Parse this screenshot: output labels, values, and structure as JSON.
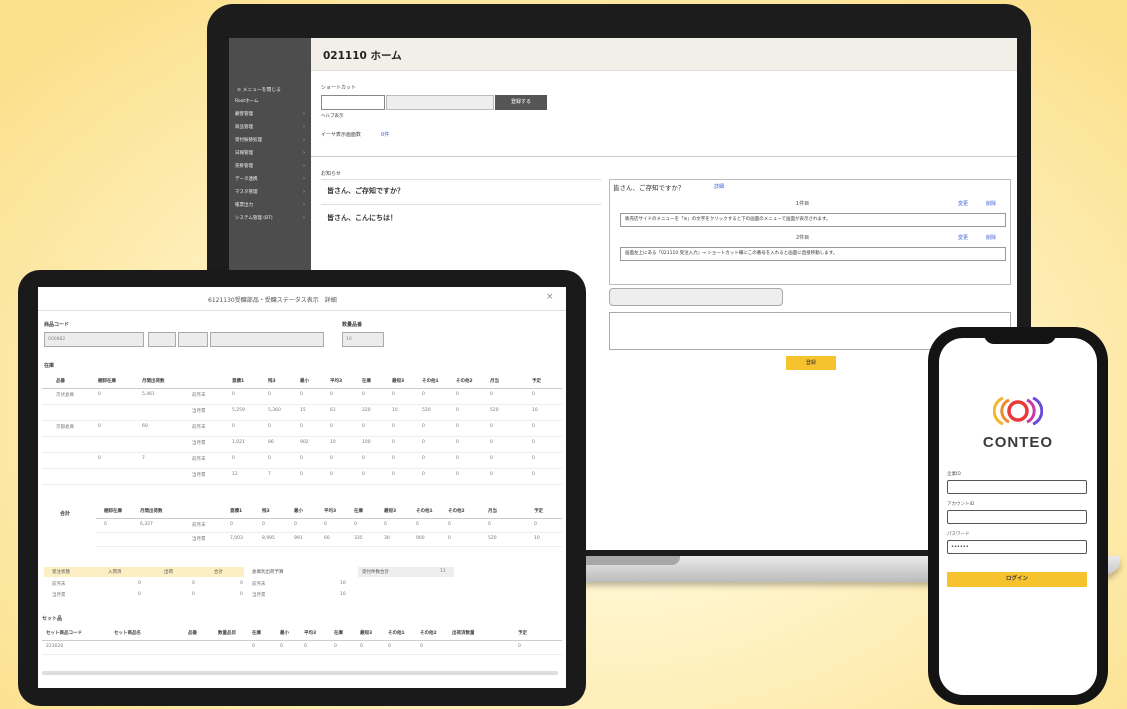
{
  "laptop": {
    "page_title": "021110 ホーム",
    "sidebar": {
      "menu_toggle": "≡ メニューを閉じる",
      "items": [
        "Rootホーム",
        "顧客管理",
        "商品管理",
        "受付振替処理",
        "日報管理",
        "売掛管理",
        "データ連携",
        "マスタ管理",
        "帳票出力",
        "システム管理 (BT)"
      ]
    },
    "shortcut": {
      "label": "ショートカット",
      "button": "登録する",
      "help": "ヘルプ表示",
      "sub_label": "イーサ表示画面数",
      "sub_value": "0件"
    },
    "messages": {
      "header": "お知らせ",
      "left": [
        "皆さん、ご存知ですか？",
        "皆さん、こんにちは！"
      ],
      "right_title": "皆さん、ご存知ですか？",
      "right_link": "詳細",
      "items": [
        {
          "label": "1件目",
          "edit": "変更",
          "delete": "削除",
          "text": "販売店サイドのメニューを「≡」の文字をクリックすると下の画面のメニューで画面が表示されます。"
        },
        {
          "label": "2件目",
          "edit": "変更",
          "delete": "削除",
          "text": "画面左上にある「021110 受注入力」→ ショートカット欄にこの番号を入れると画面に直接移動します。"
        }
      ],
      "submit": "登録"
    }
  },
  "tablet": {
    "title": "6121130受醸部品・受醸ステータス表示　詳細",
    "close": "×",
    "product_code_label": "商品コード",
    "product_code_value": "000882",
    "qty_label": "数量品番",
    "qty_value": "10",
    "section": "在庫",
    "headers": [
      "品番",
      "棚卸在庫",
      "月間出荷数",
      "",
      "直積1",
      "残3",
      "最小",
      "平均3",
      "在庫",
      "最短3",
      "その他1",
      "その他2",
      "月当",
      "予定"
    ],
    "rows": [
      [
        "京伏倉庫",
        "0",
        "5,461",
        "前月末",
        "0",
        "0",
        "0",
        "0",
        "0",
        "0",
        "0",
        "0",
        "0",
        "0"
      ],
      [
        "",
        "",
        "",
        "当月累",
        "5,259",
        "5,360",
        "15",
        "61",
        "220",
        "10",
        "520",
        "0",
        "520",
        "10"
      ],
      [
        "京都倉庫",
        "0",
        "60",
        "前月末",
        "0",
        "0",
        "0",
        "0",
        "0",
        "0",
        "0",
        "0",
        "0",
        "0"
      ],
      [
        "",
        "",
        "",
        "当月累",
        "1,021",
        "86",
        "902",
        "10",
        "100",
        "0",
        "0",
        "0",
        "0",
        "0"
      ],
      [
        "",
        "0",
        "7",
        "前月末",
        "0",
        "0",
        "0",
        "0",
        "0",
        "0",
        "0",
        "0",
        "0",
        "0"
      ],
      [
        "",
        "",
        "",
        "当月累",
        "12",
        "7",
        "0",
        "0",
        "0",
        "0",
        "0",
        "0",
        "0",
        "0"
      ]
    ],
    "total": {
      "label": "合計",
      "headers": [
        "棚卸在庫",
        "月間出荷数",
        "",
        "直積1",
        "残3",
        "最小",
        "平均3",
        "在庫",
        "最短3",
        "その他1",
        "その他2",
        "月当",
        "予定"
      ],
      "rows": [
        [
          "0",
          "6,327",
          "前月末",
          "0",
          "0",
          "0",
          "0",
          "0",
          "0",
          "0",
          "0",
          "0",
          "0"
        ],
        [
          "",
          "",
          "当月累",
          "7,003",
          "8,995",
          "991",
          "60",
          "335",
          "30",
          "900",
          "0",
          "520",
          "10"
        ]
      ]
    },
    "orders": {
      "headers": [
        "受注状態",
        "入荷済",
        "出荷",
        "合計"
      ],
      "rows": [
        [
          "前月末",
          "0",
          "0",
          "0"
        ],
        [
          "当月累",
          "0",
          "0",
          "0"
        ]
      ],
      "side": {
        "label": "倉庫別出荷予算",
        "rows": [
          [
            "前月末",
            "10"
          ],
          [
            "当月累",
            "10"
          ]
        ]
      },
      "extra": {
        "label": "受付件数合計",
        "value": "11"
      }
    },
    "set": {
      "title": "セット品",
      "headers": [
        "セット商品コード",
        "セット商品名",
        "品番",
        "数量品目",
        "在庫",
        "最小",
        "平均3",
        "在庫",
        "最短3",
        "その他1",
        "その他2",
        "出荷済数量",
        "予定"
      ],
      "row": [
        "223020",
        "",
        "",
        "",
        "0",
        "0",
        "0",
        "0",
        "0",
        "0",
        "0",
        "",
        "0"
      ]
    }
  },
  "phone": {
    "brand": "CONTEO",
    "company_label": "企業ID",
    "account_label": "アカウントID",
    "password_label": "パスワード",
    "password_value": "••••••",
    "login": "ログイン"
  },
  "colors": {
    "accent": "#f6c22d",
    "logo_red": "#e83a3a",
    "logo_gold": "#f5b52e",
    "logo_purple": "#6b4bd8"
  }
}
